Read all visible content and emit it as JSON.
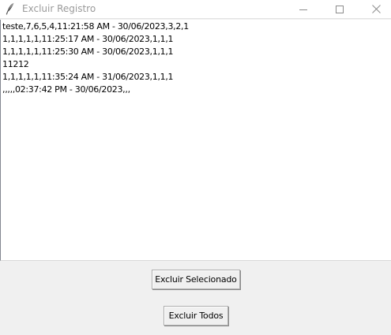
{
  "window": {
    "title": "Excluir Registro",
    "icons": {
      "app": "feather-icon",
      "minimize": "minimize-icon",
      "maximize": "maximize-icon",
      "close": "close-icon"
    }
  },
  "records": [
    "teste,7,6,5,4,11:21:58 AM - 30/06/2023,3,2,1",
    "1,1,1,1,1,11:25:17 AM - 30/06/2023,1,1,1",
    "1,1,1,1,1,11:25:30 AM - 30/06/2023,1,1,1",
    "11212",
    "1,1,1,1,1,11:35:24 AM - 31/06/2023,1,1,1",
    ",,,,,02:37:42 PM - 30/06/2023,,,"
  ],
  "buttons": {
    "delete_selected": "Excluir Selecionado",
    "delete_all": "Excluir Todos"
  }
}
